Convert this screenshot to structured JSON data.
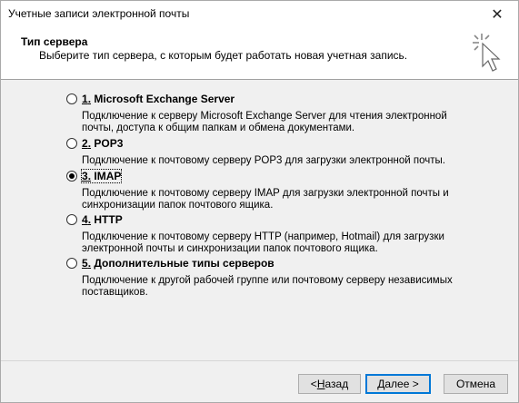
{
  "window": {
    "title": "Учетные записи электронной почты"
  },
  "header": {
    "title": "Тип сервера",
    "subtitle": "Выберите тип сервера, с которым будет работать новая учетная запись."
  },
  "options": [
    {
      "number": "1",
      "label": " Microsoft Exchange Server",
      "desc": "Подключение к серверу Microsoft Exchange Server для чтения электронной почты, доступа к общим папкам и обмена документами.",
      "checked": false
    },
    {
      "number": "2",
      "label": " POP3",
      "desc": "Подключение к почтовому серверу POP3 для загрузки электронной почты.",
      "checked": false
    },
    {
      "number": "3",
      "label": " IMAP",
      "desc": "Подключение к почтовому серверу IMAP для загрузки электронной почты и синхронизации папок почтового ящика.",
      "checked": true
    },
    {
      "number": "4",
      "label": " HTTP",
      "desc": "Подключение к почтовому серверу HTTP (например, Hotmail) для загрузки электронной почты и синхронизации папок почтового ящика.",
      "checked": false
    },
    {
      "number": "5",
      "label": " Дополнительные типы серверов",
      "desc": "Подключение к другой рабочей группе или почтовому серверу независимых поставщиков.",
      "checked": false
    }
  ],
  "buttons": {
    "back_prefix": "< ",
    "back_acc": "Н",
    "back_rest": "азад",
    "next_acc": "Д",
    "next_rest": "алее >",
    "cancel": "Отмена"
  }
}
